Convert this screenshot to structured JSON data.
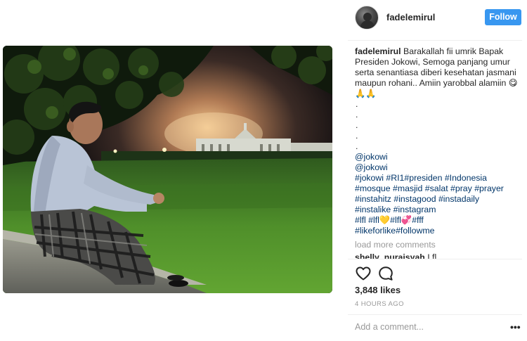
{
  "post": {
    "username": "fadelemirul",
    "follow_label": "Follow",
    "caption_username": "fadelemirul",
    "caption_text": "Barakallah fii umrik Bapak Presiden Jokowi, Semoga panjang umur serta senantiasa diberi kesehatan jasmani maupun rohani.. Amiin yarobbal alamiin 😋🙏🙏",
    "dots": [
      ".",
      ".",
      ".",
      ".",
      "."
    ],
    "tag_lines": [
      "@jokowi",
      "@jokowi",
      "#jokowi #RI1#presiden #Indonesia",
      "#mosque #masjid #salat #pray #prayer",
      "#instahitz #instagood #instadaily",
      "#instalike #instagram",
      "#lfl #lfl💛#lfl💞#fff",
      "#likeforlike#followme"
    ],
    "load_more": "load more comments",
    "next_comment_username": "shelly_nuraisyah",
    "next_comment_text": "I fl",
    "likes": "3,848 likes",
    "timestamp": "4 HOURS AGO",
    "comment_placeholder": "Add a comment...",
    "more_options": "•••"
  },
  "icons": {
    "like": "heart-icon",
    "comment": "comment-bubble-icon",
    "options": "more-options-icon"
  },
  "colors": {
    "follow_button": "#3897f0",
    "hashtag": "#003569",
    "muted": "#999999",
    "text": "#262626"
  }
}
